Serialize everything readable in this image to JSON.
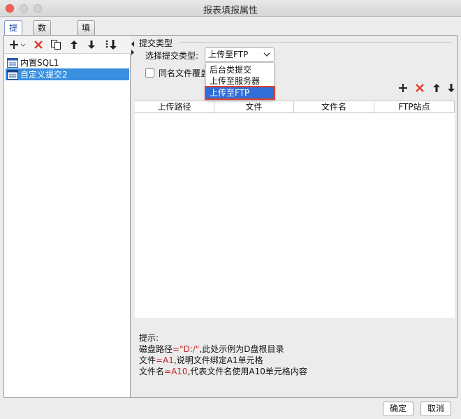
{
  "window": {
    "title": "报表填报属性"
  },
  "tabs": [
    {
      "label": "提交"
    },
    {
      "label": "数据校验"
    },
    {
      "label": "填报快捷键设置"
    }
  ],
  "left_tree": {
    "items": [
      {
        "label": "内置SQL1"
      },
      {
        "label": "自定义提交2"
      }
    ],
    "selected": "自定义提交2"
  },
  "submit_type": {
    "group_label": "提交类型",
    "select_label": "选择提交类型:",
    "selected_value": "上传至FTP",
    "options": [
      "后台类提交",
      "上传至服务器",
      "上传至FTP"
    ],
    "overwrite_checkbox_label": "同名文件覆盖"
  },
  "grid": {
    "columns": [
      "上传路径",
      "文件",
      "文件名",
      "FTP站点"
    ]
  },
  "hint": {
    "title": "提示:",
    "line1_a": "磁盘路径",
    "line1_b": "=\"D:/\"",
    "line1_c": ",此处示例为D盘根目录",
    "line2_a": "文件",
    "line2_b": "=A1",
    "line2_c": ",说明文件绑定A1单元格",
    "line3_a": "文件名",
    "line3_b": "=A10",
    "line3_c": ",代表文件名使用A10单元格内容"
  },
  "footer": {
    "ok_label": "确定",
    "cancel_label": "取消"
  },
  "colors": {
    "selection": "#3a8fe1",
    "delete_red": "#e0402f",
    "hint_red": "#c1242a"
  }
}
